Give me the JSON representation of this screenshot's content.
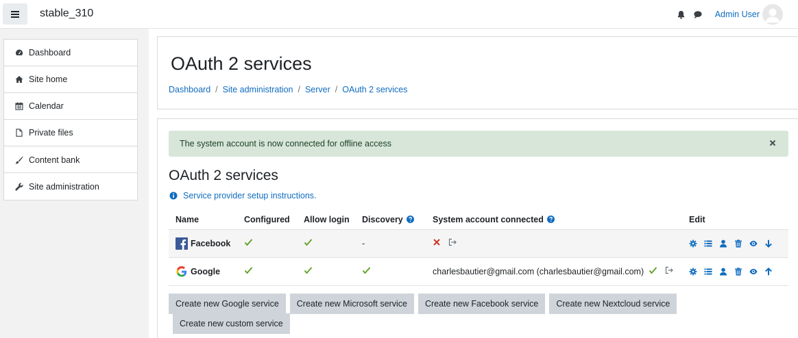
{
  "navbar": {
    "site_name": "stable_310",
    "user_name": "Admin User",
    "icons": [
      "menu-icon",
      "bell-icon",
      "chat-icon",
      "avatar"
    ]
  },
  "drawer": {
    "group1": [
      {
        "label": "Dashboard",
        "icon": "dashboard-icon"
      },
      {
        "label": "Site home",
        "icon": "home-icon"
      },
      {
        "label": "Calendar",
        "icon": "calendar-icon"
      },
      {
        "label": "Private files",
        "icon": "file-icon"
      },
      {
        "label": "Content bank",
        "icon": "brush-icon"
      }
    ],
    "group2": [
      {
        "label": "Site administration",
        "icon": "wrench-icon"
      }
    ]
  },
  "header": {
    "title": "OAuth 2 services",
    "breadcrumb": [
      "Dashboard",
      "Site administration",
      "Server",
      "OAuth 2 services"
    ],
    "separator": "/"
  },
  "main": {
    "alert": "The system account is now connected for offline access",
    "section_title": "OAuth 2 services",
    "instructions_link": "Service provider setup instructions.",
    "table": {
      "headers": {
        "name": "Name",
        "configured": "Configured",
        "allow_login": "Allow login",
        "discovery": "Discovery",
        "system_account": "System account connected",
        "edit": "Edit"
      },
      "rows": [
        {
          "name": "Facebook",
          "logo": "facebook-logo",
          "configured": "check",
          "allow_login": "check",
          "discovery": "-",
          "system_account": "",
          "system_account_status": "cross"
        },
        {
          "name": "Google",
          "logo": "google-logo",
          "configured": "check",
          "allow_login": "check",
          "discovery": "check",
          "system_account": "charlesbautier@gmail.com (charlesbautier@gmail.com)",
          "system_account_status": "check"
        }
      ],
      "edit_icons": [
        "gear-icon",
        "list-icon",
        "user-icon",
        "trash-icon",
        "eye-icon",
        "arrow-icon"
      ]
    },
    "buttons": [
      "Create new Google service",
      "Create new Microsoft service",
      "Create new Facebook service",
      "Create new Nextcloud service",
      "Create new custom service"
    ]
  },
  "colors": {
    "link": "#0f6cbf",
    "success": "#5e9e1f",
    "danger": "#ca3120",
    "alert_bg": "#d7e6d9",
    "button_bg": "#ced4da"
  }
}
